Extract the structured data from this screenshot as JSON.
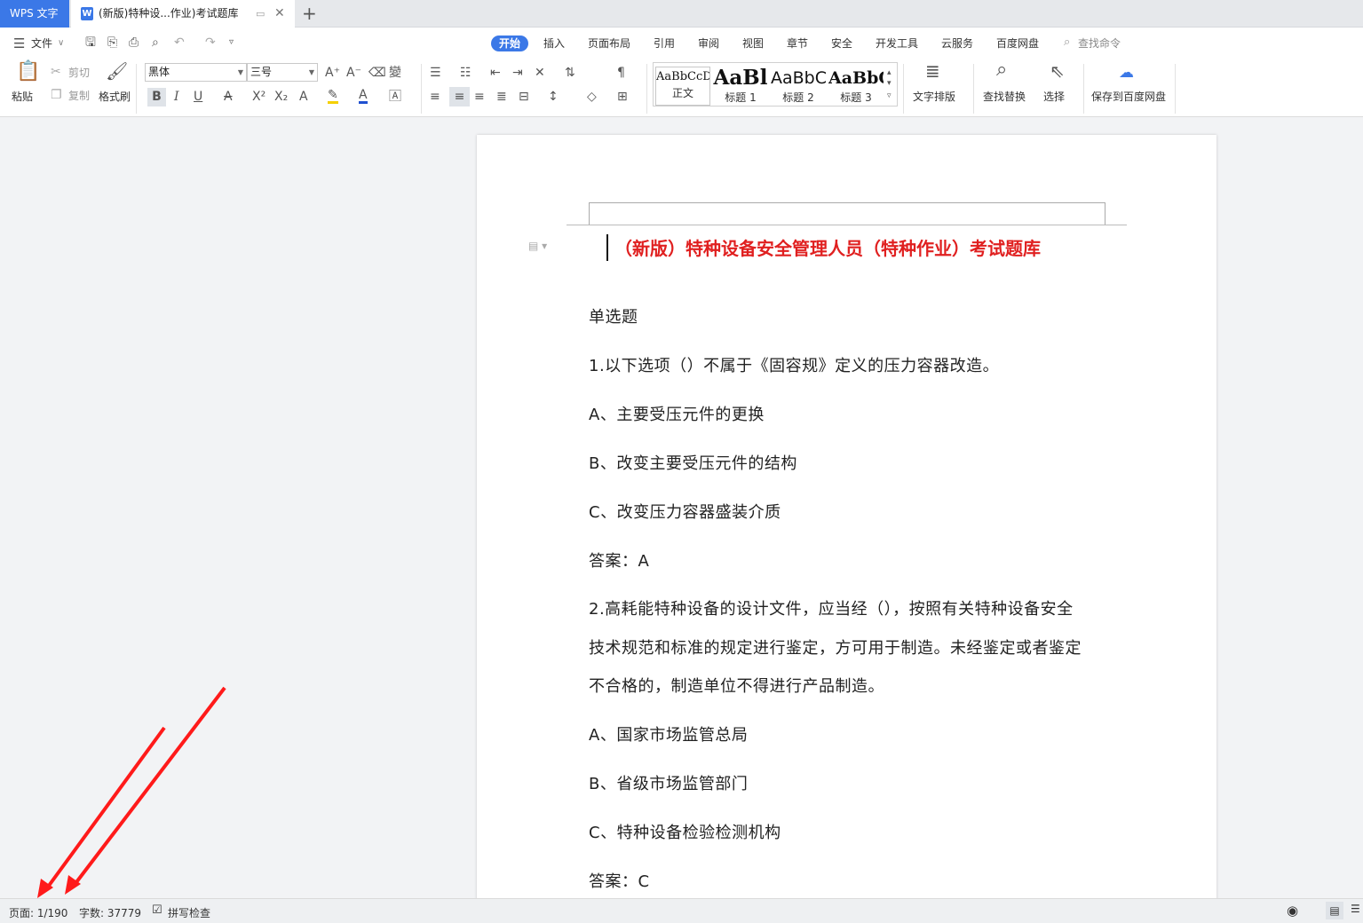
{
  "tabs": {
    "app_label": "WPS 文字",
    "doc_tab_icon": "W",
    "doc_tab_title": "(新版)特种设...作业)考试题库",
    "new_tab": "+"
  },
  "menubar": {
    "file_label": "文件",
    "tabs": [
      "开始",
      "插入",
      "页面布局",
      "引用",
      "审阅",
      "视图",
      "章节",
      "安全",
      "开发工具",
      "云服务",
      "百度网盘"
    ],
    "search_label": "查找命令"
  },
  "ribbon": {
    "paste": "粘贴",
    "cut": "剪切",
    "copy": "复制",
    "format_painter": "格式刷",
    "font_name": "黑体",
    "font_size": "三号",
    "styles": [
      {
        "preview": "AaBbCcDd",
        "label": "正文"
      },
      {
        "preview": "AaBl",
        "label": "标题 1"
      },
      {
        "preview": "AaBbC",
        "label": "标题 2"
      },
      {
        "preview": "AaBbC",
        "label": "标题 3"
      }
    ],
    "text_layout": "文字排版",
    "find_replace": "查找替换",
    "select": "选择",
    "save_baidu": "保存到百度网盘"
  },
  "document": {
    "title": "（新版）特种设备安全管理人员（特种作业）考试题库",
    "lines": [
      "单选题",
      "1.以下选项（）不属于《固容规》定义的压力容器改造。",
      "A、主要受压元件的更换",
      "B、改变主要受压元件的结构",
      "C、改变压力容器盛装介质",
      "答案：A",
      "2.高耗能特种设备的设计文件，应当经（），按照有关特种设备安全",
      "技术规范和标准的规定进行鉴定，方可用于制造。未经鉴定或者鉴定",
      "不合格的，制造单位不得进行产品制造。",
      "A、国家市场监管总局",
      "B、省级市场监管部门",
      "C、特种设备检验检测机构",
      "答案：C"
    ]
  },
  "status": {
    "page": "页面: 1/190",
    "word_count": "字数: 37779",
    "spell_check": "拼写检查"
  },
  "colors": {
    "accent": "#3b78e7",
    "title_red": "#e02020",
    "annotation_arrow": "#ff1a1a"
  }
}
